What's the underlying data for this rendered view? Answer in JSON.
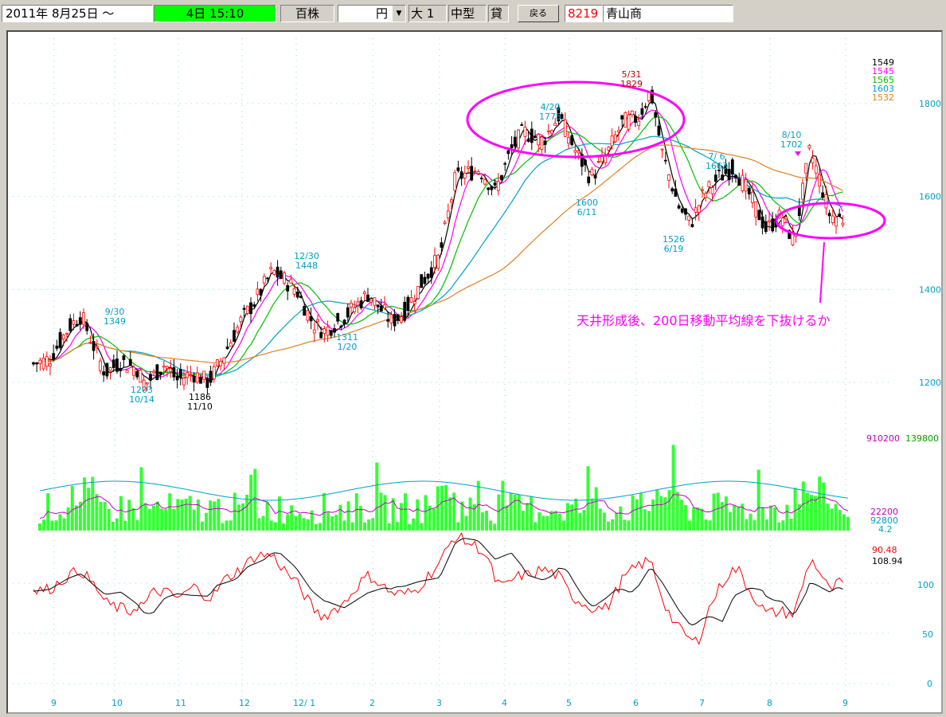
{
  "toolbar": {
    "date_start": "2011年  8月25日 ～",
    "date_span": "4日  15:10",
    "unit": "百株",
    "currency": "円",
    "size": "大 1",
    "model": "中型",
    "lend": "貸",
    "back_button": "戻る",
    "code": "8219",
    "name": "青山商"
  },
  "colors": {
    "up": "#ff0000",
    "down": "#000000",
    "ma5": "#000000",
    "ma25": "#ff00ff",
    "ma50": "#00c000",
    "ma100": "#00a0c8",
    "ma200": "#e08020",
    "accent": "#ff00ff",
    "volume": "#33ff33",
    "axis": "#00a0c8",
    "status_bg": "#00ff00"
  },
  "chart_data": {
    "type": "candlestick",
    "x_ticks": [
      "9",
      "10",
      "11",
      "12",
      "12/ 1",
      "2",
      "3",
      "4",
      "5",
      "6",
      "7",
      "8",
      "9"
    ],
    "y_ticks": [
      "1800",
      "1600",
      "1400",
      "1200"
    ],
    "ylim": [
      1200,
      1800
    ],
    "ma_legend": [
      "1549",
      "1545",
      "1565",
      "1603",
      "1532"
    ],
    "annotations": [
      {
        "date": "9/30",
        "value": "1349"
      },
      {
        "date": "10/14",
        "value": "1203"
      },
      {
        "date": "11/10",
        "value": "1186"
      },
      {
        "date": "12/30",
        "value": "1448"
      },
      {
        "date": "1/20",
        "value": "1311"
      },
      {
        "date": "4/20",
        "value": "1775"
      },
      {
        "date": "5/31",
        "value": "1829"
      },
      {
        "date": "6/11",
        "value": "1600"
      },
      {
        "date": "6/19",
        "value": "1526"
      },
      {
        "date": "7/ 6",
        "value": "1663"
      },
      {
        "date": "8/10",
        "value": "1702"
      }
    ],
    "comment": "天井形成後、200日移動平均線を下抜けるか",
    "volume": {
      "labels_top": [
        "910200",
        "139800"
      ],
      "labels_bottom": [
        "22200",
        "92800",
        "4.2"
      ]
    },
    "oscillator": {
      "labels": [
        "90.48",
        "108.94"
      ],
      "y_ticks": [
        "100",
        "50",
        "0"
      ]
    }
  }
}
